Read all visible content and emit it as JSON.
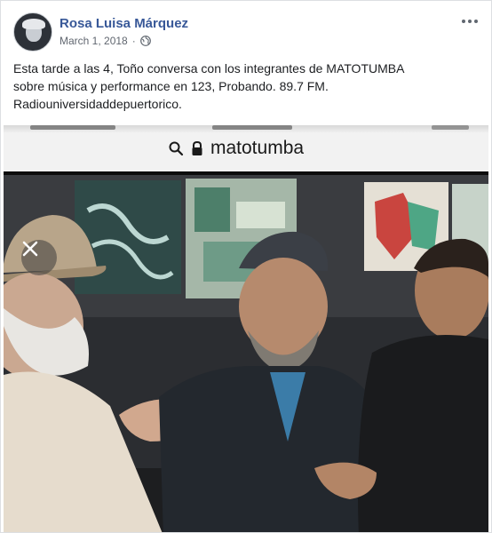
{
  "post": {
    "author": "Rosa Luisa Márquez",
    "date": "March 1, 2018",
    "separator": "·",
    "privacy_icon": "globe-icon",
    "more_icon": "more-options-icon",
    "text_lines": [
      "Esta tarde a las 4, Toño conversa con los integrantes de MATOTUMBA",
      "sobre música y performance en 123, Probando. 89.7 FM.",
      "Radiouniversidaddepuertorico."
    ]
  },
  "media": {
    "address_bar": {
      "search_icon": "search-icon",
      "lock_icon": "lock-icon",
      "url": "matotumba"
    },
    "video": {
      "close_icon": "close-icon"
    }
  },
  "colors": {
    "author_link": "#385898",
    "meta_text": "#616770",
    "body_text": "#1c1e21"
  }
}
